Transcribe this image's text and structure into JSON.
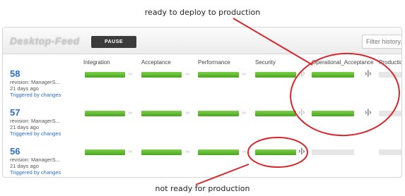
{
  "annotations": {
    "top_note": "ready to deploy to production",
    "bottom_note": "not ready for production"
  },
  "pipeline": {
    "name": "Desktop-Feed",
    "pause_label": "PAUSE",
    "filter_placeholder": "Filter history..."
  },
  "stages": [
    "Integration",
    "Acceptance",
    "Performance",
    "Security",
    "Operational_Acceptance",
    "Production_"
  ],
  "runs": [
    {
      "number": "58",
      "revision": "revision: ManagerS...",
      "age": "21 days ago",
      "trigger": "Triggered by changes"
    },
    {
      "number": "57",
      "revision": "revision: ManagerS...",
      "age": "21 days ago",
      "trigger": "Triggered by changes"
    },
    {
      "number": "56",
      "revision": "revision: ManagerS...",
      "age": "21 days ago",
      "trigger": "Triggered by changes"
    }
  ],
  "colors": {
    "passed": "#5cb82f",
    "pending": "#e6e6e6",
    "annotation": "#d9262c",
    "link": "#2a6fc9"
  }
}
